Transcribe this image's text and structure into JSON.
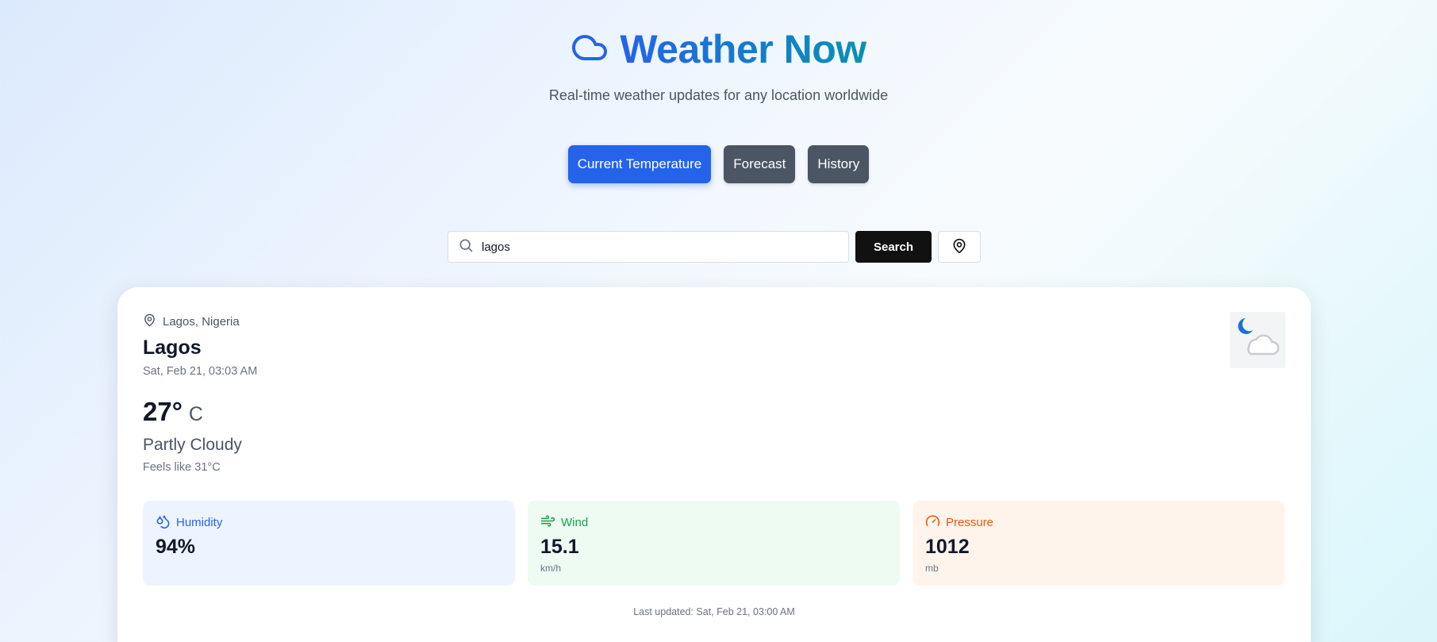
{
  "header": {
    "icon": "cloud-icon",
    "title": "Weather Now",
    "subtitle": "Real-time weather updates for any location worldwide",
    "gradient": [
      "#2563eb",
      "#0891b2"
    ]
  },
  "tabs": [
    {
      "label": "Current Temperature",
      "active": true
    },
    {
      "label": "Forecast",
      "active": false
    },
    {
      "label": "History",
      "active": false
    }
  ],
  "search": {
    "value": "lagos",
    "button_label": "Search",
    "search_icon": "search-icon",
    "location_icon": "map-pin-icon"
  },
  "weather": {
    "location": "Lagos, Nigeria",
    "city": "Lagos",
    "datetime": "Sat, Feb 21, 03:03 AM",
    "temperature": "27°",
    "unit": "C",
    "condition": "Partly Cloudy",
    "feels_like": "Feels like 31°C",
    "condition_icon": "moon-cloud-icon"
  },
  "stats": {
    "humidity": {
      "label": "Humidity",
      "value": "94%",
      "icon": "droplets-icon",
      "color": "#2563eb"
    },
    "wind": {
      "label": "Wind",
      "value": "15.1",
      "unit": "km/h",
      "icon": "wind-icon",
      "color": "#16a34a"
    },
    "pressure": {
      "label": "Pressure",
      "value": "1012",
      "unit": "mb",
      "icon": "gauge-icon",
      "color": "#ea580c"
    }
  },
  "last_updated": "Last updated: Sat, Feb 21, 03:00 AM",
  "colors": {
    "active_tab": "#2563eb",
    "inactive_tab": "#4b5563",
    "search_button": "#111111"
  }
}
